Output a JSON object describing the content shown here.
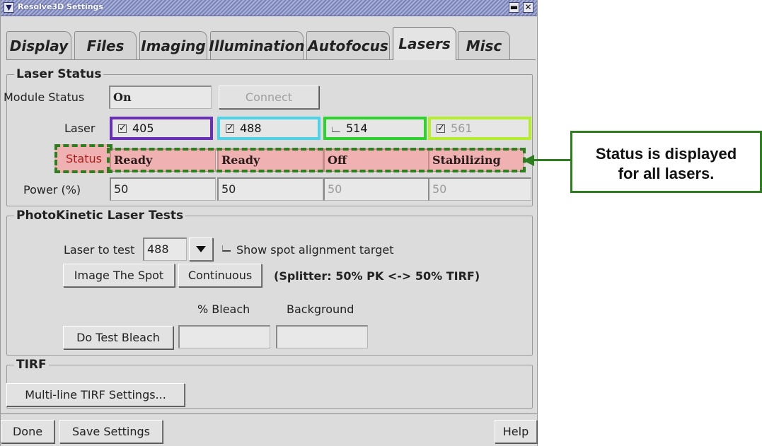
{
  "window": {
    "title": "Resolve3D Settings",
    "menu_icon": "chevron-down-icon",
    "minimize_symbol": "▬",
    "close_symbol": "✕"
  },
  "tabs": [
    {
      "label": "Display",
      "active": false
    },
    {
      "label": "Files",
      "active": false
    },
    {
      "label": "Imaging",
      "active": false
    },
    {
      "label": "Illumination",
      "active": false
    },
    {
      "label": "Autofocus",
      "active": false
    },
    {
      "label": "Lasers",
      "active": true
    },
    {
      "label": "Misc",
      "active": false
    }
  ],
  "laser_status": {
    "group_title": "Laser Status",
    "module_status_label": "Module Status",
    "module_status_value": "On",
    "connect_label": "Connect",
    "laser_label": "Laser",
    "status_label": "Status",
    "power_label": "Power (%)",
    "lasers": [
      {
        "wavelength": "405",
        "checked": true,
        "status": "Ready",
        "power": "50",
        "border_color": "#6a2fb8",
        "enabled": true
      },
      {
        "wavelength": "488",
        "checked": true,
        "status": "Ready",
        "power": "50",
        "border_color": "#4fd2e6",
        "enabled": true
      },
      {
        "wavelength": "514",
        "checked": false,
        "status": "Off",
        "power": "50",
        "border_color": "#2fd12f",
        "enabled": true
      },
      {
        "wavelength": "561",
        "checked": true,
        "status": "Stabilizing",
        "power": "50",
        "border_color": "#b5ee2e",
        "enabled": false
      }
    ]
  },
  "photokinetic": {
    "group_title": "PhotoKinetic Laser Tests",
    "laser_to_test_label": "Laser to test",
    "laser_to_test_value": "488",
    "show_spot_label": "Show spot alignment target",
    "image_spot_label": "Image The Spot",
    "continuous_label": "Continuous",
    "splitter_text": "(Splitter: 50% PK <-> 50% TIRF)",
    "bleach_header": "% Bleach",
    "background_header": "Background",
    "do_test_bleach_label": "Do Test Bleach",
    "bleach_value": "",
    "background_value": ""
  },
  "tirf": {
    "group_title": "TIRF",
    "multiline_label": "Multi-line TIRF Settings..."
  },
  "footer": {
    "done_label": "Done",
    "save_label": "Save Settings",
    "help_label": "Help"
  },
  "callout": {
    "line1": "Status is displayed",
    "line2": "for all lasers.",
    "color": "#2e7d1e"
  }
}
